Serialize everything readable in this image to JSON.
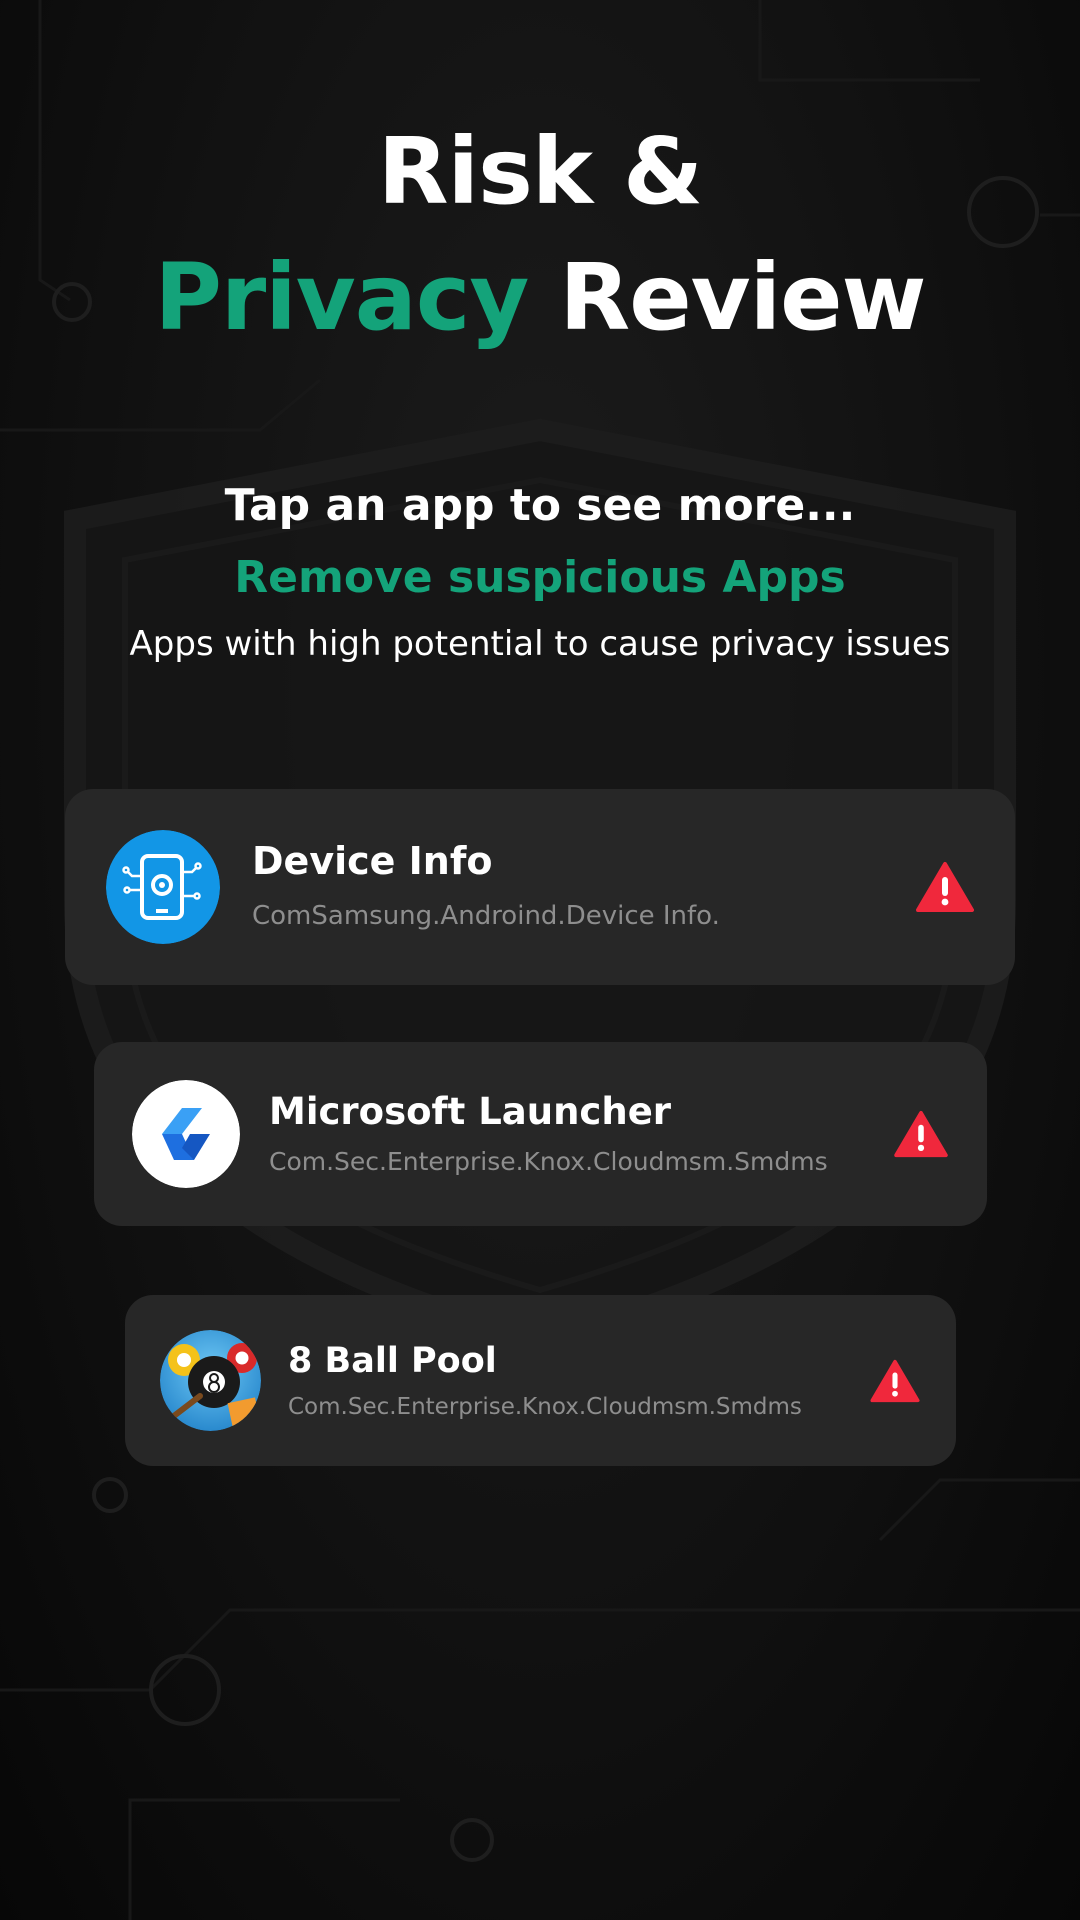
{
  "header": {
    "title_line1": "Risk &",
    "title_accent": "Privacy",
    "title_rest": "Review"
  },
  "intro": {
    "tap_text": "Tap an app to see more...",
    "remove_text": "Remove suspicious Apps",
    "description": "Apps with high potential to cause privacy issues"
  },
  "apps": [
    {
      "name": "Device Info",
      "package": "ComSamsung.Androind.Device Info.",
      "icon": "device-info-icon",
      "status_icon": "warning-icon"
    },
    {
      "name": "Microsoft Launcher",
      "package": "Com.Sec.Enterprise.Knox.Cloudmsm.Smdms",
      "icon": "microsoft-launcher-icon",
      "status_icon": "warning-icon"
    },
    {
      "name": "8 Ball Pool",
      "package": "Com.Sec.Enterprise.Knox.Cloudmsm.Smdms",
      "icon": "8-ball-pool-icon",
      "status_icon": "warning-icon"
    }
  ],
  "colors": {
    "accent": "#14a37a",
    "card_bg": "#272727",
    "warning": "#f0283c",
    "device_info_blue": "#1296e6",
    "launcher_blue": "#1e6fe0"
  }
}
